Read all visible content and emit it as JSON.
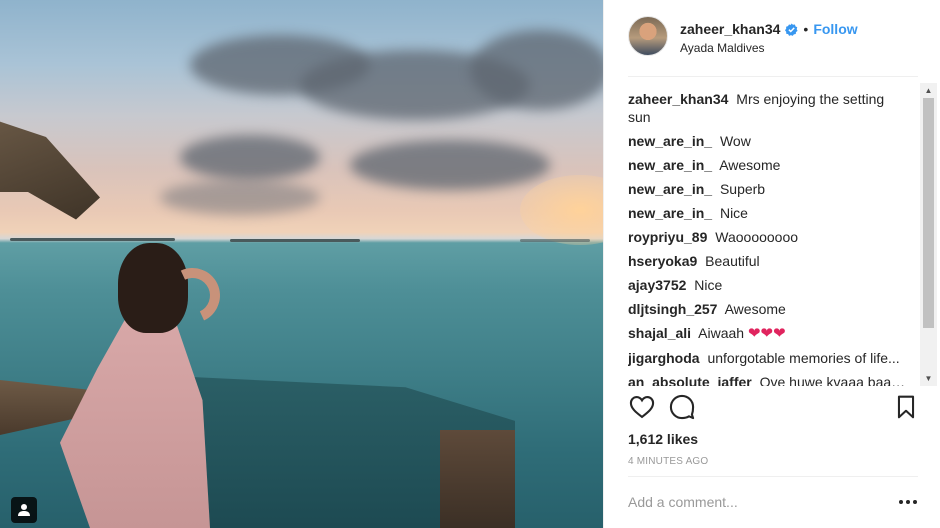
{
  "post": {
    "author": {
      "username": "zaheer_khan34",
      "verified": true,
      "follow_label": "Follow",
      "location": "Ayada Maldives"
    },
    "comments": [
      {
        "user": "zaheer_khan34",
        "text": "Mrs enjoying the setting sun"
      },
      {
        "user": "new_are_in_",
        "text": "Wow"
      },
      {
        "user": "new_are_in_",
        "text": "Awesome"
      },
      {
        "user": "new_are_in_",
        "text": "Superb"
      },
      {
        "user": "new_are_in_",
        "text": "Nice"
      },
      {
        "user": "roypriyu_89",
        "text": "Waoooooooo"
      },
      {
        "user": "hseryoka9",
        "text": "Beautiful"
      },
      {
        "user": "ajay3752",
        "text": "Nice"
      },
      {
        "user": "dljtsingh_257",
        "text": "Awesome"
      },
      {
        "user": "shajal_ali",
        "text": "Aiwaah",
        "hearts": "❤❤❤"
      },
      {
        "user": "jigarghoda",
        "text": "unforgotable memories of life..."
      },
      {
        "user": "an_absolute_jaffer",
        "text": "Ove huwe kvaaa baaaat"
      }
    ],
    "likes": "1,612 likes",
    "time_ago": "4 MINUTES AGO",
    "add_comment_placeholder": "Add a comment...",
    "icons": {
      "like": "heart-outline-icon",
      "comment": "comment-bubble-icon",
      "save": "bookmark-icon",
      "more": "more-options-icon",
      "tag": "user-tag-icon",
      "verified": "verified-badge-icon"
    },
    "colors": {
      "follow": "#3897f0",
      "verified": "#3897f0",
      "hearts": "#e0245e"
    }
  }
}
